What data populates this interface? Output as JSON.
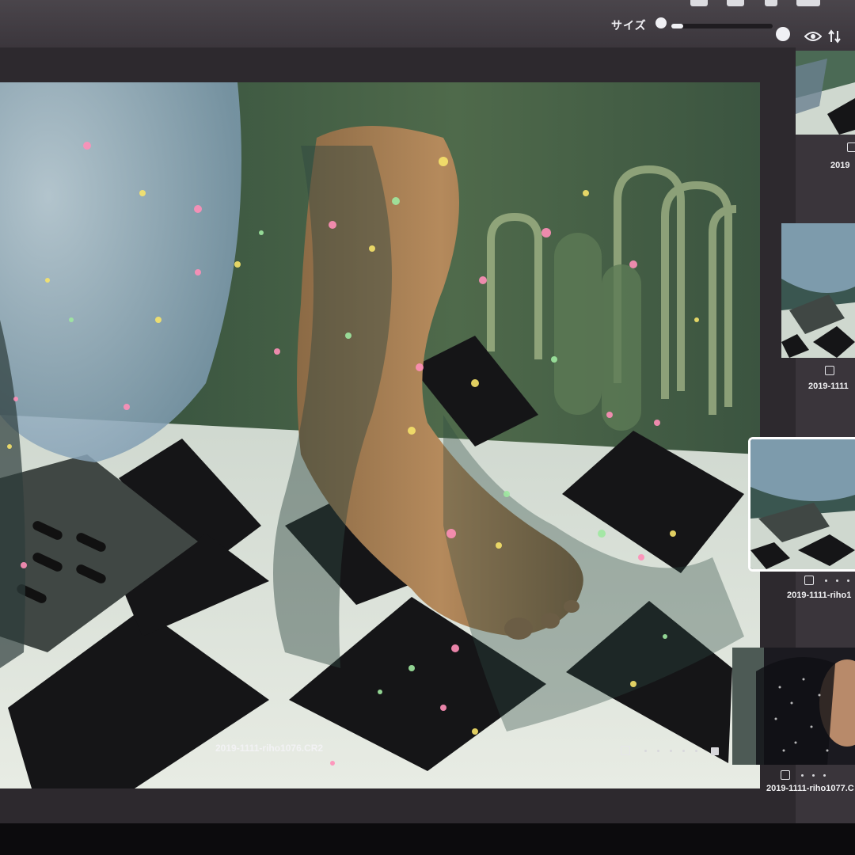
{
  "toolbar": {
    "size_label": "サイズ",
    "size_slider_value": 0.12,
    "icons": [
      "zoom-out-icon",
      "zoom-in-icon",
      "eye-icon",
      "sort-icon"
    ]
  },
  "viewer": {
    "filename": "2019-1111-riho1076.CR2",
    "rating": {
      "flagged": false,
      "dots": 5
    }
  },
  "filmstrip": {
    "items": [
      {
        "label": "2019",
        "selected": false
      },
      {
        "label": "2019-1111",
        "selected": false
      },
      {
        "label": "2019-1111-riho1",
        "selected": true
      },
      {
        "label": "2019-1111-riho1077.C",
        "selected": false
      }
    ]
  },
  "colors": {
    "window_bg": "#3a353b",
    "viewer_bg": "#2d292e",
    "selection_border": "#ffffff",
    "text": "#f2f2f4"
  }
}
